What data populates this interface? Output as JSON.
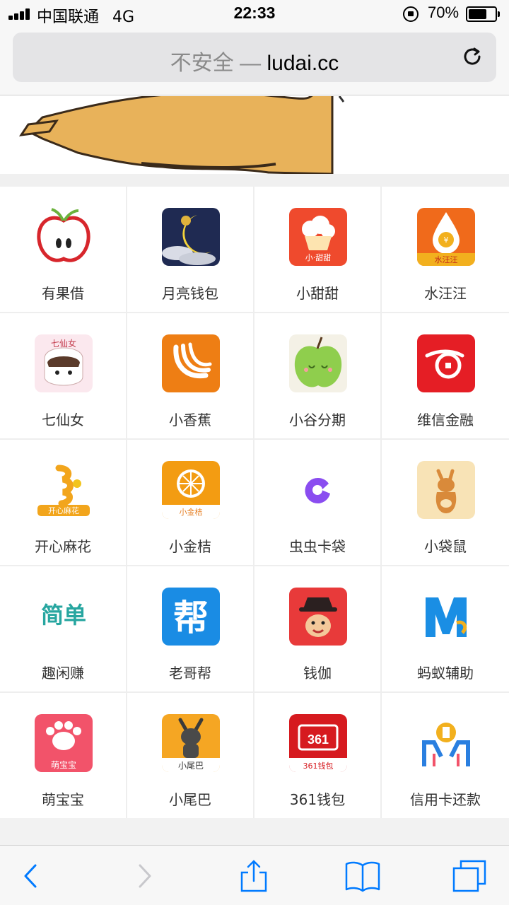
{
  "status": {
    "carrier": "中国联通",
    "network": "4G",
    "time": "22:33",
    "battery_percent": "70%",
    "battery_level": 0.7
  },
  "browser": {
    "security_label": "不安全",
    "separator": " — ",
    "domain": "ludai.cc"
  },
  "apps": [
    {
      "label": "有果借",
      "icon": "apple-icon"
    },
    {
      "label": "月亮钱包",
      "icon": "moon-icon"
    },
    {
      "label": "小甜甜",
      "icon": "cupcake-icon",
      "icon_text": "小·甜甜"
    },
    {
      "label": "水汪汪",
      "icon": "drop-icon",
      "icon_text": "水汪汪"
    },
    {
      "label": "七仙女",
      "icon": "fairy-icon",
      "icon_text": "七仙女"
    },
    {
      "label": "小香蕉",
      "icon": "banana-icon"
    },
    {
      "label": "小谷分期",
      "icon": "green-apple-icon"
    },
    {
      "label": "维信金融",
      "icon": "coin-swoosh-icon"
    },
    {
      "label": "开心麻花",
      "icon": "twist-icon",
      "icon_text": "开心麻花"
    },
    {
      "label": "小金桔",
      "icon": "orange-icon",
      "icon_text": "小金桔"
    },
    {
      "label": "虫虫卡袋",
      "icon": "pacman-icon"
    },
    {
      "label": "小袋鼠",
      "icon": "kangaroo-icon"
    },
    {
      "label": "趣闲赚",
      "icon": "jiandan-icon",
      "icon_text": "简单"
    },
    {
      "label": "老哥帮",
      "icon": "bang-icon",
      "icon_text": "帮"
    },
    {
      "label": "钱伽",
      "icon": "hat-face-icon"
    },
    {
      "label": "蚂蚁辅助",
      "icon": "letter-m-icon"
    },
    {
      "label": "萌宝宝",
      "icon": "paw-icon",
      "icon_text": "萌宝宝"
    },
    {
      "label": "小尾巴",
      "icon": "raccoon-icon",
      "icon_text": "小尾巴"
    },
    {
      "label": "361钱包",
      "icon": "wallet-361-icon",
      "icon_text": "361",
      "icon_subtext": "361钱包"
    },
    {
      "label": "信用卡还款",
      "icon": "card-repay-icon"
    }
  ],
  "colors": {
    "accent": "#007aff",
    "label_text": "#333333"
  }
}
